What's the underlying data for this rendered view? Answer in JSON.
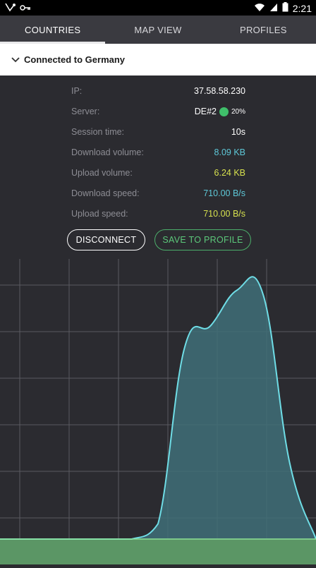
{
  "status_bar": {
    "time": "2:21",
    "icons": [
      "notification-icon",
      "key-icon",
      "wifi-icon",
      "signal-icon",
      "battery-icon"
    ]
  },
  "tabs": [
    {
      "label": "COUNTRIES",
      "active": true
    },
    {
      "label": "MAP VIEW",
      "active": false
    },
    {
      "label": "PROFILES",
      "active": false
    }
  ],
  "connection": {
    "title": "Connected to Germany",
    "expand_icon": "chevron-down-icon"
  },
  "details": {
    "ip": {
      "label": "IP:",
      "value": "37.58.58.230"
    },
    "server": {
      "label": "Server:",
      "value": "DE#2",
      "load": "20%",
      "status_color": "#3fbf6a"
    },
    "session_time": {
      "label": "Session time:",
      "value": "10s"
    },
    "download_volume": {
      "label": "Download volume:",
      "value": "8.09 KB"
    },
    "upload_volume": {
      "label": "Upload volume:",
      "value": "6.24 KB"
    },
    "download_speed": {
      "label": "Download speed:",
      "value": "710.00 B/s"
    },
    "upload_speed": {
      "label": "Upload speed:",
      "value": "710.00 B/s"
    }
  },
  "buttons": {
    "disconnect": "DISCONNECT",
    "save_to_profile": "SAVE TO PROFILE"
  },
  "colors": {
    "accent_cyan": "#5ec8d8",
    "accent_yellow": "#d6e04e",
    "accent_green": "#4caf6b",
    "background": "#2b2b30"
  },
  "chart_data": {
    "type": "area",
    "title": "",
    "xlabel": "",
    "ylabel": "",
    "grid": true,
    "series": [
      {
        "name": "",
        "values": [
          0,
          0,
          0,
          0,
          0,
          0,
          0.06,
          0.75,
          0.84,
          0.98,
          0.96,
          0.3,
          0
        ]
      },
      {
        "name": "",
        "values": [
          0,
          0,
          0,
          0,
          0,
          0,
          0,
          0,
          0,
          0,
          0,
          0,
          0
        ]
      }
    ]
  }
}
